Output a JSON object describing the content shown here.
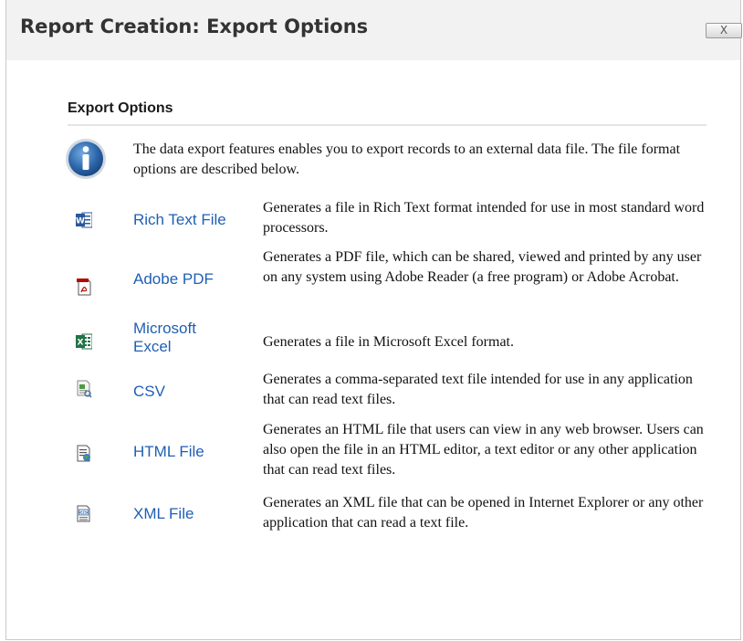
{
  "dialog": {
    "title": "Report Creation: Export Options",
    "close_label": "X"
  },
  "section": {
    "title": "Export Options",
    "intro": "The data export features enables you to export records to an external data file. The file format options are described below."
  },
  "formats": [
    {
      "name": "Rich Text File",
      "icon": "word-doc-icon",
      "description": "Generates a file in Rich Text format intended for use in most standard word processors."
    },
    {
      "name": "Adobe PDF",
      "icon": "pdf-icon",
      "description": "Generates a PDF file, which can be shared, viewed and printed by any user on any system using Adobe Reader (a free program) or Adobe Acrobat."
    },
    {
      "name": "Microsoft Excel",
      "icon": "excel-icon",
      "description": "Generates a file in Microsoft Excel format."
    },
    {
      "name": "CSV",
      "icon": "csv-icon",
      "description": "Generates a comma-separated text file intended for use in any application that can read text files."
    },
    {
      "name": "HTML File",
      "icon": "html-file-icon",
      "description": "Generates an HTML file that users can view in any web browser. Users can also open the file in an HTML editor, a text editor or any other application that can read text files."
    },
    {
      "name": "XML File",
      "icon": "xml-file-icon",
      "description": "Generates an XML file that can be opened in Internet Explorer or any other application that can read a text file."
    }
  ],
  "colors": {
    "link": "#1f5fb4",
    "titlebar": "#f2f2f2",
    "info_icon": "#2f6fb0"
  }
}
